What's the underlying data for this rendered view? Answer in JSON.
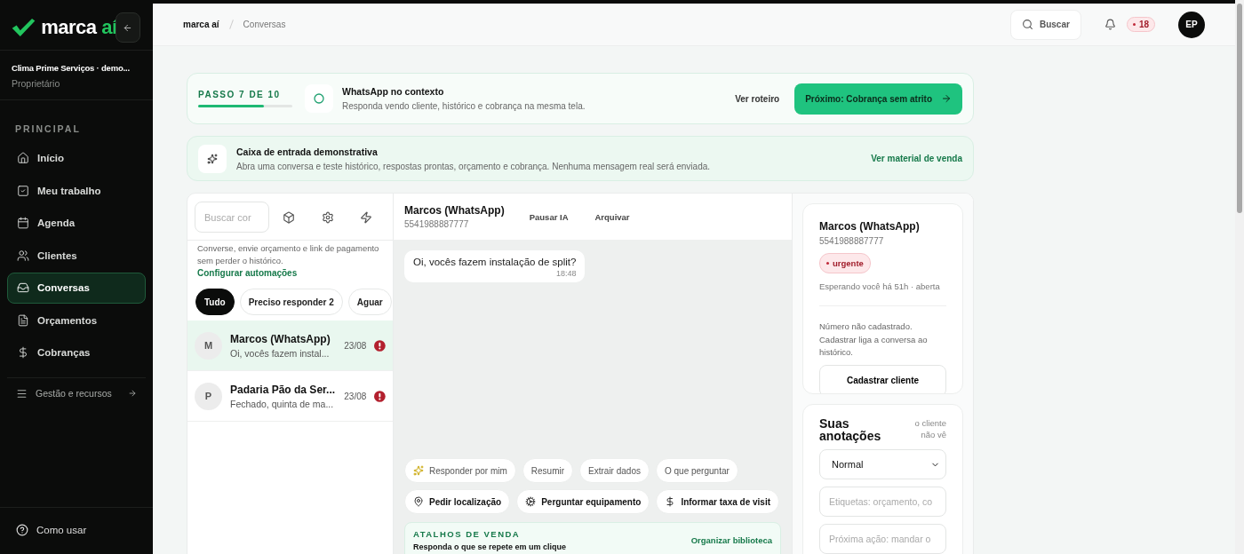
{
  "sidebar": {
    "logo": {
      "text": "marca",
      "accent": "aí"
    },
    "org": {
      "name": "Clima Prime Serviços · demo...",
      "role": "Proprietário"
    },
    "section": "PRINCIPAL",
    "items": [
      {
        "label": "Início",
        "selected": false
      },
      {
        "label": "Meu trabalho",
        "selected": false
      },
      {
        "label": "Agenda",
        "selected": false
      },
      {
        "label": "Clientes",
        "selected": false
      },
      {
        "label": "Conversas",
        "selected": true
      },
      {
        "label": "Orçamentos",
        "selected": false
      },
      {
        "label": "Cobranças",
        "selected": false
      }
    ],
    "more": "Gestão e recursos",
    "help": "Como usar"
  },
  "header": {
    "breadcrumb": [
      "marca aí",
      "Conversas"
    ],
    "search": "Buscar",
    "notifications": "18",
    "avatar": "EP"
  },
  "step": {
    "label": "PASSO 7 DE 10",
    "level": 0.7,
    "title": "WhatsApp no contexto",
    "subtitle": "Responda vendo cliente, histórico e cobrança na mesma tela.",
    "link": "Ver roteiro",
    "next": "Próximo: Cobrança sem atrito"
  },
  "banner": {
    "title": "Caixa de entrada demonstrativa",
    "text": "Abra uma conversa e teste histórico, respostas prontas, orçamento e cobrança. Nenhuma mensagem real será enviada.",
    "link": "Ver material de venda"
  },
  "list": {
    "search": {
      "placeholder": "Buscar cor"
    },
    "description": "Converse, envie orçamento e link de pagamento sem perder o histórico.",
    "description_link": "Configurar automações",
    "filters": [
      {
        "label": "Tudo",
        "selected": true
      },
      {
        "label": "Preciso responder 2",
        "selected": false
      },
      {
        "label": "Aguar",
        "selected": false
      }
    ],
    "conversations": [
      {
        "initial": "M",
        "name": "Marcos (WhatsApp)",
        "preview": "Oi, vocês fazem instal...",
        "date": "23/08",
        "urgent": true,
        "selected": true
      },
      {
        "initial": "P",
        "name": "Padaria Pão da Ser...",
        "preview": "Fechado, quinta de ma...",
        "date": "23/08",
        "urgent": true,
        "selected": false
      }
    ]
  },
  "chat": {
    "name": "Marcos (WhatsApp)",
    "phone": "5541988887777",
    "actions": [
      "Pausar IA",
      "Arquivar"
    ],
    "messages": [
      {
        "text": "Oi, vocês fazem instalação de split?",
        "time": "18:48"
      }
    ],
    "quick_actions": [
      [
        {
          "label": "Responder por mim",
          "kind": "ai"
        },
        {
          "label": "Resumir",
          "kind": "plain"
        },
        {
          "label": "Extrair dados",
          "kind": "plain"
        },
        {
          "label": "O que perguntar",
          "kind": "plain"
        }
      ],
      [
        {
          "label": "Pedir localização",
          "kind": "pin"
        },
        {
          "label": "Perguntar equipamento",
          "kind": "cog"
        },
        {
          "label": "Informar taxa de visit",
          "kind": "dollar"
        }
      ]
    ],
    "shortcuts": {
      "title": "ATALHOS DE VENDA",
      "subtitle": "Responda o que se repete em um clique",
      "link": "Organizar biblioteca"
    }
  },
  "contact": {
    "name": "Marcos (WhatsApp)",
    "phone": "5541988887777",
    "tag": "urgente",
    "status": "Esperando você há 51h · aberta",
    "note": "Número não cadastrado. Cadastrar liga a conversa ao histórico.",
    "button": "Cadastrar cliente"
  },
  "notes": {
    "title": "Suas anotações",
    "hint": "o cliente não vê",
    "priority": "Normal",
    "tags": {
      "placeholder": "Etiquetas: orçamento, co"
    },
    "next_action": {
      "placeholder": "Próxima ação: mandar o"
    }
  }
}
